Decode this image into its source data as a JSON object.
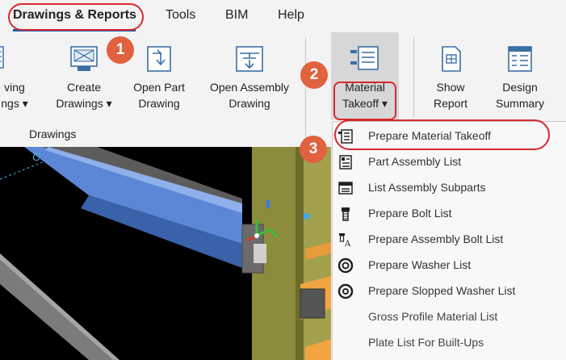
{
  "tabs": [
    {
      "label": "Drawings & Reports",
      "active": true
    },
    {
      "label": "Tools",
      "active": false
    },
    {
      "label": "BIM",
      "active": false
    },
    {
      "label": "Help",
      "active": false
    }
  ],
  "ribbon": {
    "drawings_group": {
      "label": "Drawings",
      "partial_button": {
        "line1": "ving",
        "line2": "ngs ▾"
      },
      "create_drawings": {
        "line1": "Create",
        "line2": "Drawings ▾"
      },
      "open_part_drawing": {
        "line1": "Open Part",
        "line2": "Drawing"
      },
      "open_assembly_drawing": {
        "line1": "Open Assembly",
        "line2": "Drawing"
      }
    },
    "material_takeoff": {
      "line1": "Material",
      "line2": "Takeoff ▾"
    },
    "show_report": {
      "line1": "Show",
      "line2": "Report"
    },
    "design_summary": {
      "line1": "Design",
      "line2": "Summary"
    }
  },
  "viewport": {
    "grid_label": "C"
  },
  "menu": {
    "items": [
      {
        "label": "Prepare Material Takeoff",
        "icon": "material-takeoff-icon"
      },
      {
        "label": "Part Assembly List",
        "icon": "part-list-icon"
      },
      {
        "label": "List Assembly Subparts",
        "icon": "subparts-icon"
      },
      {
        "label": "Prepare Bolt List",
        "icon": "bolt-icon"
      },
      {
        "label": "Prepare Assembly Bolt List",
        "icon": "assembly-bolt-icon"
      },
      {
        "label": "Prepare Washer List",
        "icon": "washer-icon"
      },
      {
        "label": "Prepare Slopped Washer List",
        "icon": "slopped-washer-icon"
      },
      {
        "label": "Gross Profile Material List",
        "icon": ""
      },
      {
        "label": "Plate List For Built-Ups",
        "icon": ""
      }
    ]
  },
  "steps": [
    "1",
    "2",
    "3"
  ],
  "colors": {
    "highlight": "#d9272e",
    "badge": "#e0623e",
    "accent": "#1a5aa8"
  }
}
